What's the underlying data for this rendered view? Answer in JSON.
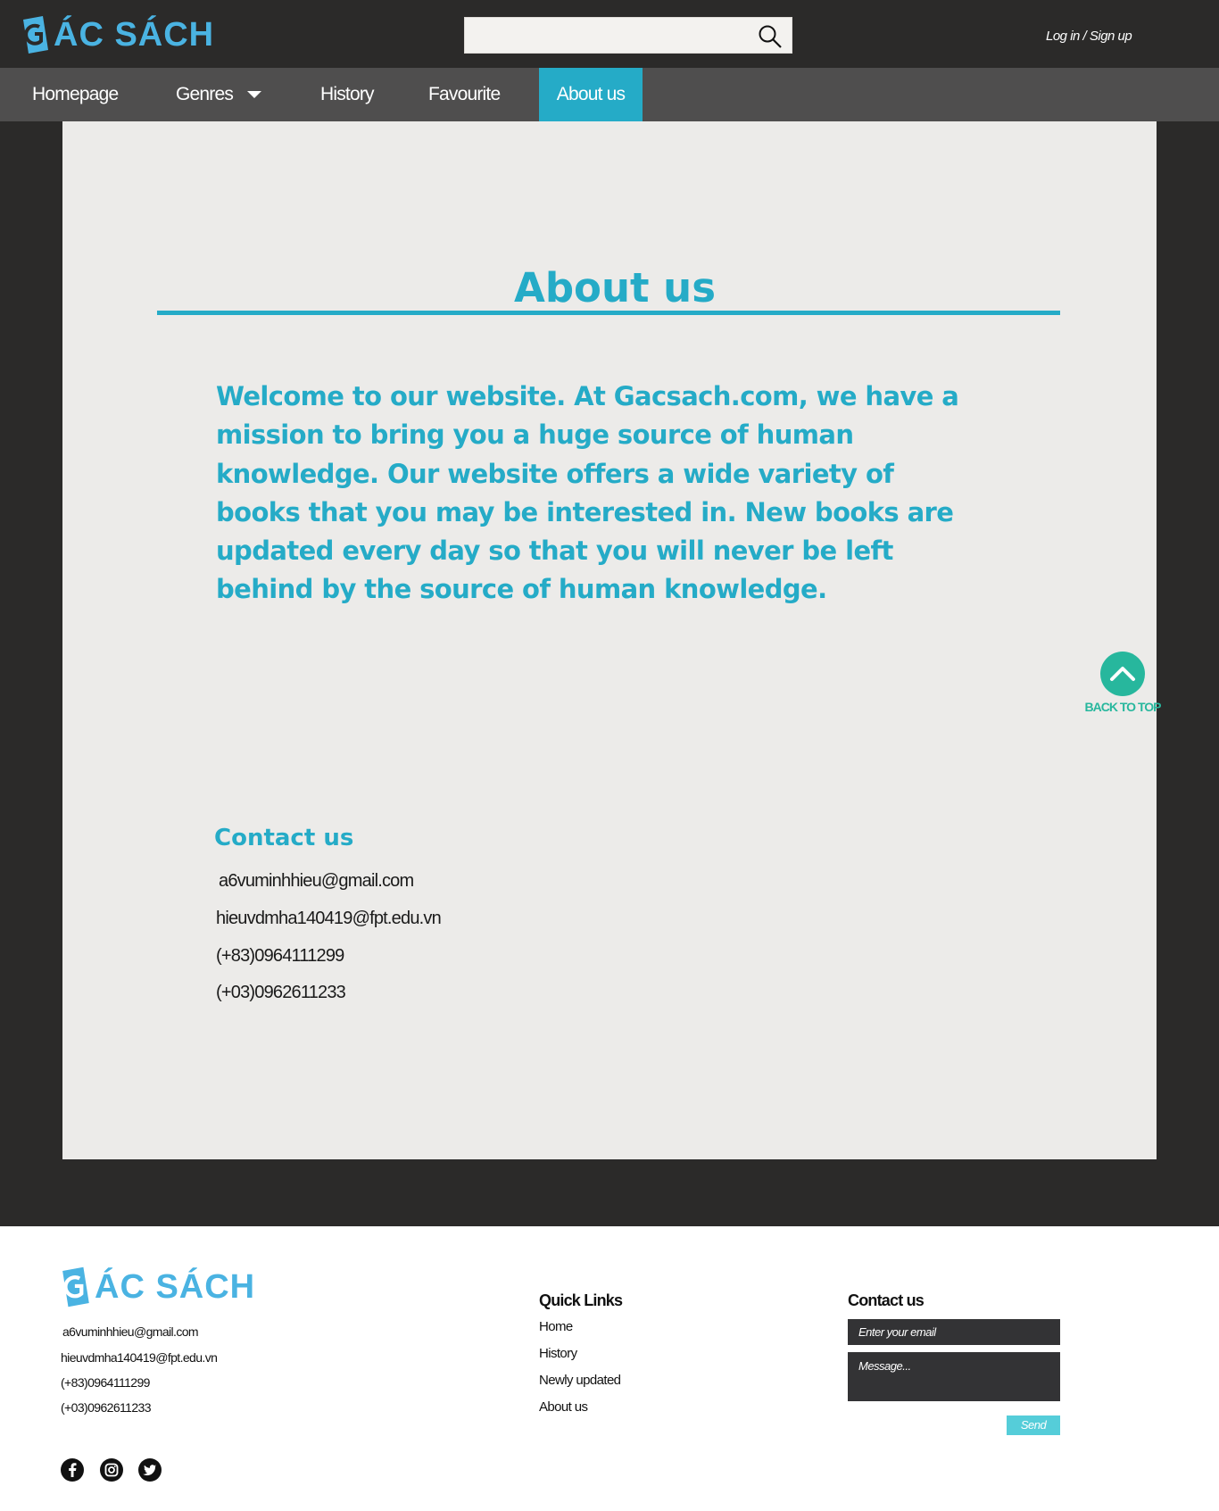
{
  "brand": {
    "logo_text": "ÁC SÁCH",
    "logo_letter": "G",
    "accent": "#25abc7",
    "logo_color": "#4ab3e2",
    "dark_bg": "#2b2a29"
  },
  "header": {
    "search": {
      "placeholder": "",
      "icon": "search-icon"
    },
    "login_label": "Log in / Sign up"
  },
  "nav": {
    "items": [
      {
        "label": "Homepage"
      },
      {
        "label": "Genres"
      },
      {
        "label": "History"
      },
      {
        "label": "Favourite"
      },
      {
        "label": "About us"
      }
    ],
    "active": "About us"
  },
  "main": {
    "title": "About us",
    "paragraph": "Welcome to our website. At Gacsach.com, we have a mission to bring you a huge source of human knowledge. Our website offers a wide variety of books that you may be interested in. New books are updated every day so that you will never be left behind by the source of human knowledge.",
    "back_to_top": "BACK TO TOP",
    "contact": {
      "title": "Contact us",
      "lines": [
        "a6vuminhhieu@gmail.com",
        "hieuvdmha140419@fpt.edu.vn",
        "(+83)0964111299",
        "(+03)0962611233"
      ]
    }
  },
  "footer": {
    "contact_lines": [
      "a6vuminhhieu@gmail.com",
      "hieuvdmha140419@fpt.edu.vn",
      "(+83)0964111299",
      "(+03)0962611233"
    ],
    "social": [
      "facebook-icon",
      "instagram-icon",
      "twitter-icon"
    ],
    "quick_links": {
      "title": "Quick Links",
      "items": [
        "Home",
        "History",
        "Newly updated",
        "About us"
      ]
    },
    "contact_form": {
      "title": "Contact us",
      "email_placeholder": "Enter your email",
      "message_placeholder": "Message...",
      "send_label": "Send"
    }
  }
}
